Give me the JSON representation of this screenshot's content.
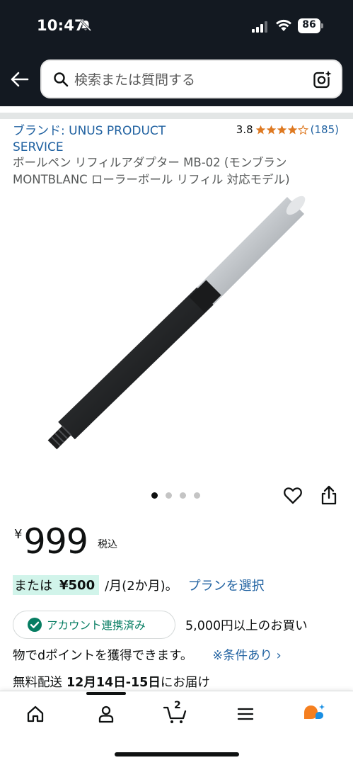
{
  "status_bar": {
    "time": "10:47",
    "battery": "86"
  },
  "search": {
    "placeholder": "検索または質問する"
  },
  "product": {
    "brand": "ブランド: UNUS PRODUCT SERVICE",
    "rating": "3.8",
    "rating_value": 3.8,
    "rating_count": "(185)",
    "title": "ボールペン リフィルアダプター MB-02 (モンブラン MONTBLANC ローラーボール リフィル 対応モデル)",
    "image_count": 4,
    "active_image": 1
  },
  "price": {
    "currency": "¥",
    "amount": "999",
    "tax_label": "税込"
  },
  "installment": {
    "prefix": "または",
    "amount": "¥500",
    "term": "/月(2か月)。",
    "link": "プランを選択"
  },
  "points": {
    "badge": "アカウント連携済み",
    "text_line1": "5,000円以上のお買い",
    "text_line2": "物でdポイントを獲得できます。",
    "conditions_link": "※条件あり ›"
  },
  "delivery": {
    "prefix": "無料配送",
    "dates": "12月14日-15日",
    "suffix": "にお届け"
  },
  "tabbar": {
    "cart_count": "2",
    "active_tab": "account"
  },
  "colors": {
    "header_bg": "#131921",
    "link": "#2162a1",
    "star": "#de7921",
    "installment_highlight": "#d1f4ea",
    "linked_green": "#067d62",
    "rufus_orange": "#f57f1f",
    "rufus_blue": "#1a8fe3"
  },
  "icons": {
    "back": "arrow-left-icon",
    "search": "search-icon",
    "camera": "camera-lens-icon",
    "heart": "heart-icon",
    "share": "share-icon",
    "check": "check-circle-icon",
    "home": "home-icon",
    "account": "person-icon",
    "cart": "cart-icon",
    "menu": "hamburger-icon",
    "rufus": "rufus-chat-icon"
  }
}
